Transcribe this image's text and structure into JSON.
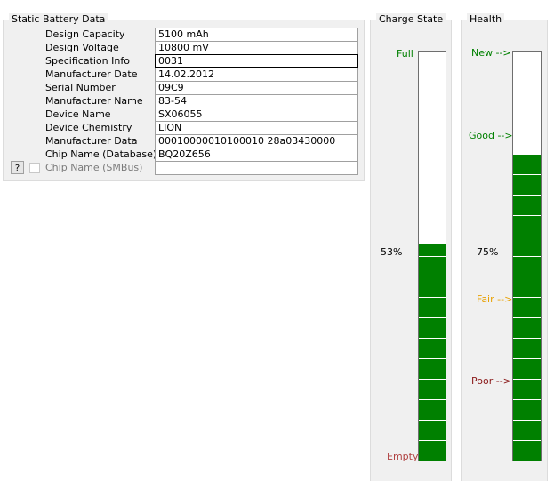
{
  "static_battery": {
    "title": "Static Battery Data",
    "rows": [
      {
        "label": "Design Capacity",
        "value": "5100 mAh"
      },
      {
        "label": "Design Voltage",
        "value": "10800 mV"
      },
      {
        "label": "Specification Info",
        "value": "0031"
      },
      {
        "label": "Manufacturer Date",
        "value": "14.02.2012"
      },
      {
        "label": "Serial Number",
        "value": "09C9"
      },
      {
        "label": "Manufacturer Name",
        "value": "83-54"
      },
      {
        "label": "Device Name",
        "value": "SX06055"
      },
      {
        "label": "Device Chemistry",
        "value": "LION"
      },
      {
        "label": "Manufacturer Data",
        "value": "00010000010100010 28a03430000"
      },
      {
        "label": "Chip Name (Database)",
        "value": "BQ20Z656"
      },
      {
        "label": "Chip Name (SMBus)",
        "value": ""
      }
    ],
    "help_label": "?"
  },
  "charge_state": {
    "title": "Charge State",
    "full_label": "Full",
    "empty_label": "Empty",
    "percent_label": "53%",
    "level": 0.53
  },
  "health": {
    "title": "Health",
    "new_label": "New -->",
    "good_label": "Good -->",
    "fair_label": "Fair -->",
    "poor_label": "Poor -->",
    "percent_label": "75%",
    "level": 0.75
  },
  "colors": {
    "bar_fill": "#008000",
    "full": "#008000",
    "empty": "#b04040",
    "new": "#008000",
    "good": "#008000",
    "fair": "#e8a000",
    "poor": "#8b1a1a"
  }
}
